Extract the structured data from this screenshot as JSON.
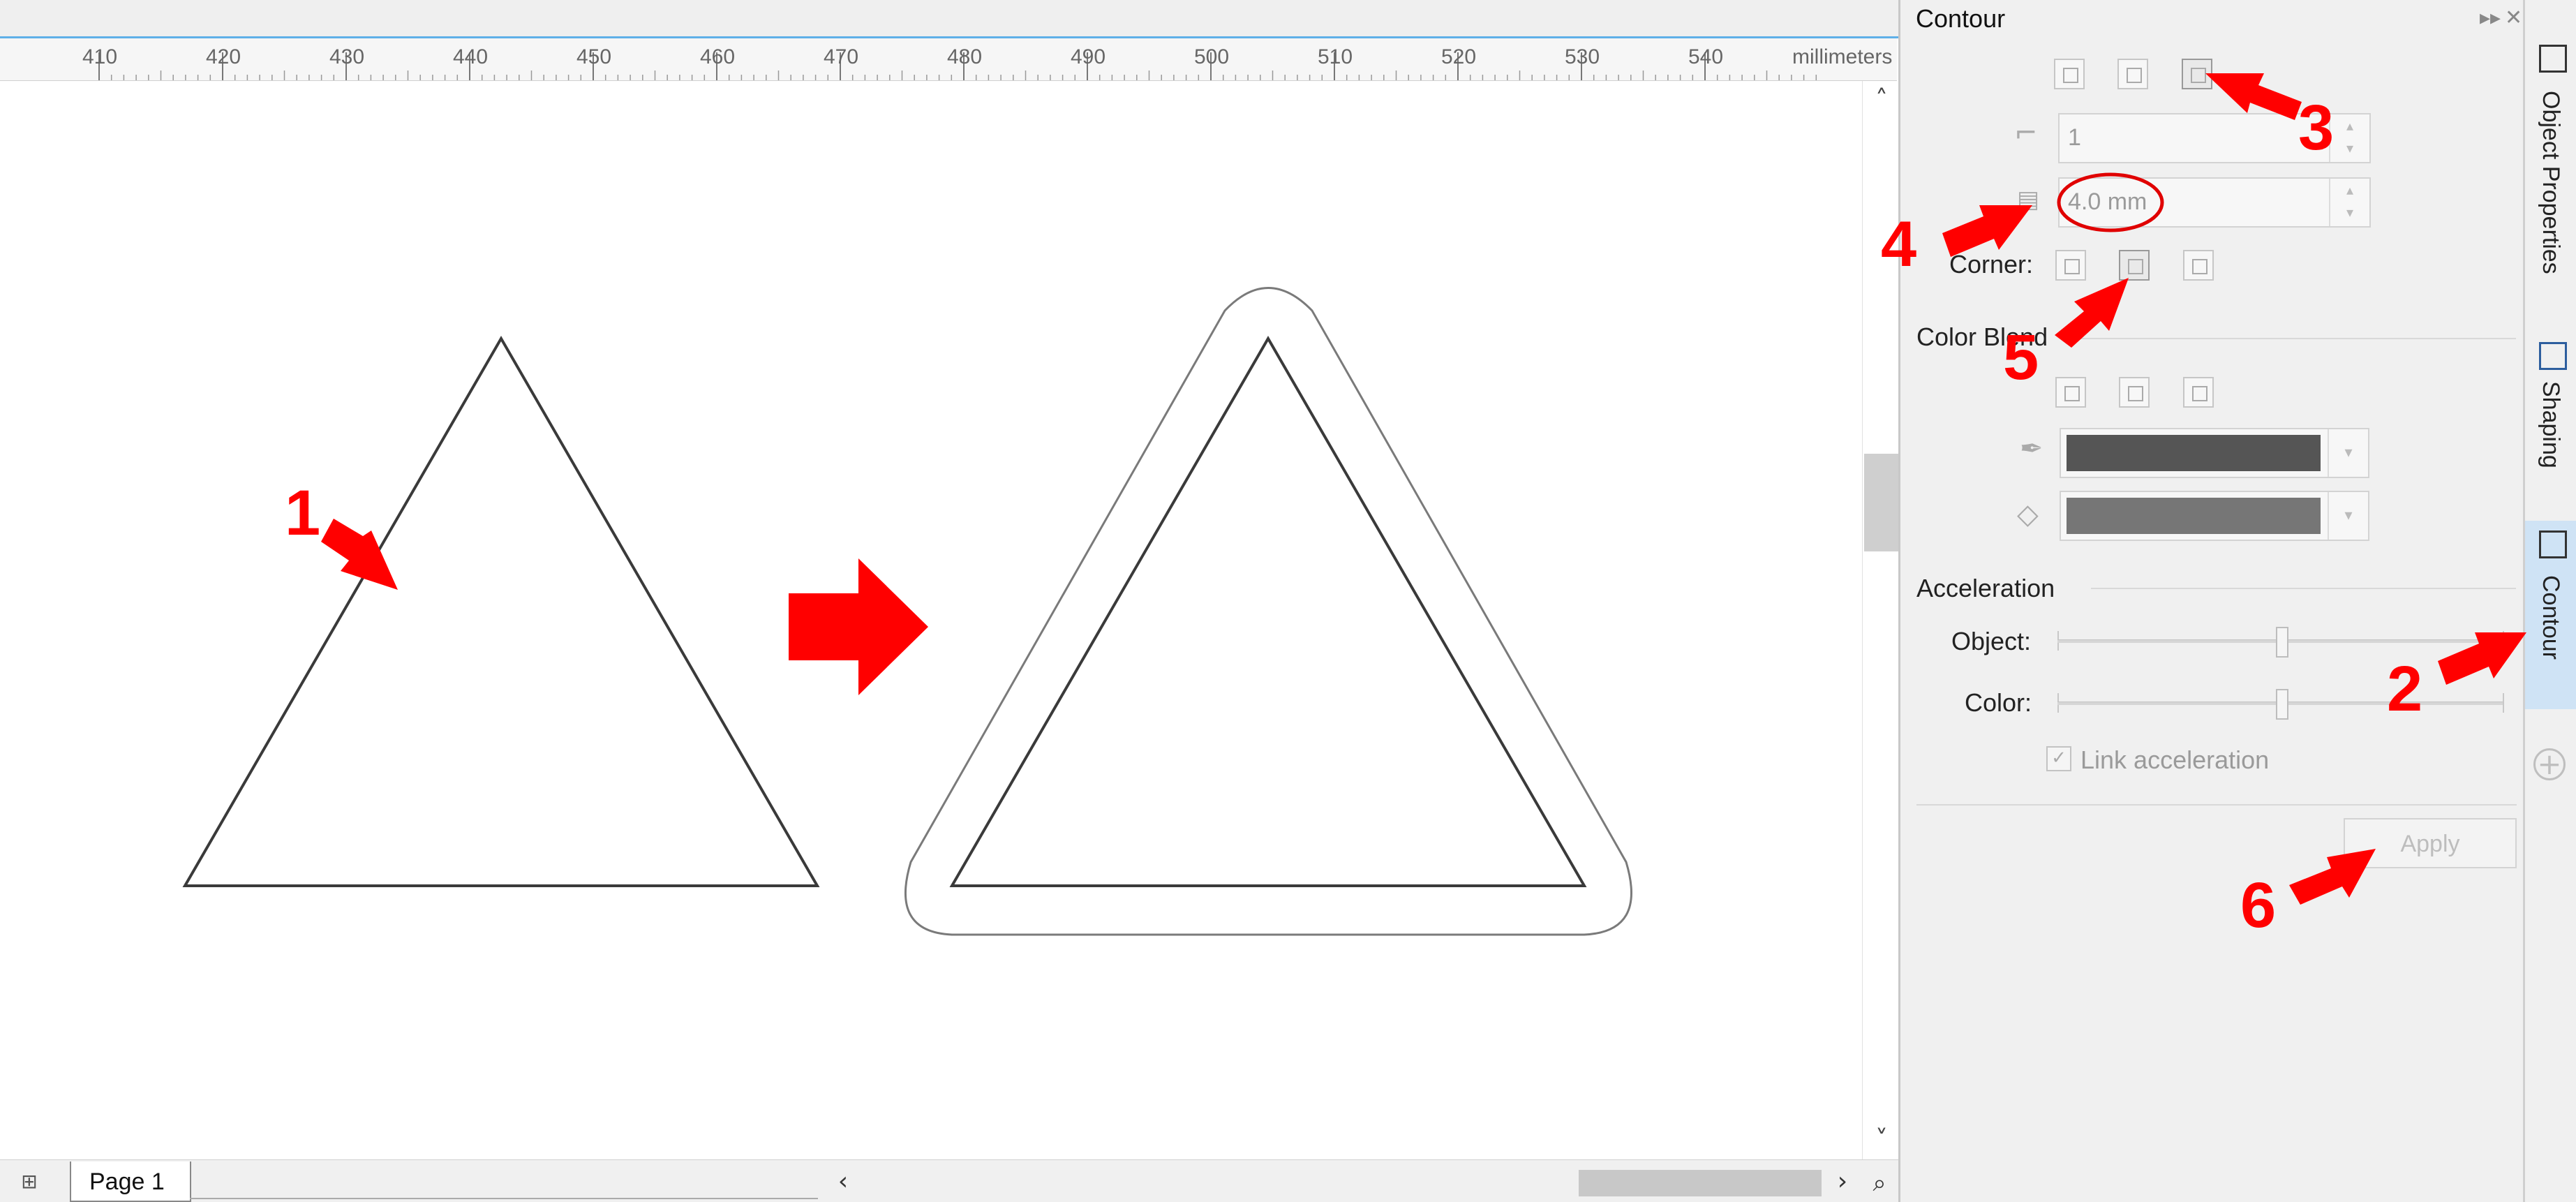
{
  "ruler": {
    "ticks": [
      "410",
      "420",
      "430",
      "440",
      "450",
      "460",
      "470",
      "480",
      "490",
      "500",
      "510",
      "520",
      "530",
      "540"
    ],
    "unit": "millimeters"
  },
  "canvas": {
    "page_tab": "Page 1"
  },
  "docker": {
    "title": "Contour",
    "steps_value": "1",
    "offset_value": "4.0 mm",
    "corner_label": "Corner:",
    "color_blend_label": "Color Blend",
    "outline_color": "#555555",
    "fill_color": "#767676",
    "acceleration_label": "Acceleration",
    "object_label": "Object:",
    "color_label": "Color:",
    "object_accel": 0.5,
    "color_accel": 0.5,
    "link_acceleration": "Link acceleration",
    "apply_label": "Apply"
  },
  "tabs": {
    "object_properties": "Object Properties",
    "shaping": "Shaping",
    "contour": "Contour"
  },
  "annotations": [
    "1",
    "2",
    "3",
    "4",
    "5",
    "6"
  ],
  "colors": {
    "accent": "#ff0000",
    "active_tab": "#cfe3f5"
  }
}
